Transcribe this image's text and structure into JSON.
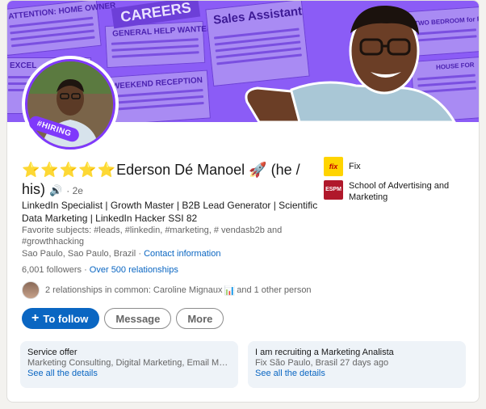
{
  "profile": {
    "stars": "⭐⭐⭐⭐⭐",
    "name": "Ederson Dé Manoel",
    "emoji": "🚀",
    "pronouns": "(he / his)",
    "degree": "· 2e",
    "headline": "LinkedIn Specialist | Growth Master | B2B Lead Generator | Scientific Data Marketing | LinkedIn Hacker SSI 82",
    "subjects": "Favorite subjects: #leads, #linkedin, #marketing, # vendasb2b and #growthhacking",
    "location": "Sao Paulo, Sao Paulo, Brazil",
    "contact_link": "Contact information",
    "followers": "6,001  followers",
    "relationships_link": "Over 500  relationships",
    "hiring_badge": "#HIRING"
  },
  "banner": {
    "careers": "CAREERS",
    "sales": "Sales Assistant",
    "help_wanted": "GENERAL HELP WANTED",
    "weekend": "WEEKEND RECEPTION",
    "home_owner": "ATTENTION: HOME OWNER",
    "two_bedroom": "TWO BEDROOM for RENT",
    "house_for": "HOUSE FOR",
    "excel": "EXCEL"
  },
  "mutual": {
    "text": "2 relationships in common: Caroline Mignaux",
    "chart_icon": "📊",
    "suffix": " and 1 other person"
  },
  "actions": {
    "follow": "To follow",
    "message": "Message",
    "more": "More"
  },
  "companies": [
    {
      "logo_text": "fix",
      "name": "Fix"
    },
    {
      "logo_text": "ESPM",
      "name": "School of Advertising and Marketing"
    }
  ],
  "service_offer": {
    "title": "Service offer",
    "description": "Marketing Consulting, Digital Marketing, Email Mark...",
    "link": "See all the details"
  },
  "recruiting": {
    "title": "I am recruiting a Marketing Analista",
    "description": "Fix São Paulo, Brasil 27 days ago",
    "link": "See all the details"
  },
  "colors": {
    "banner": "#8b5cf6",
    "accent": "#0a66c2",
    "hiring": "#7f39fb"
  }
}
